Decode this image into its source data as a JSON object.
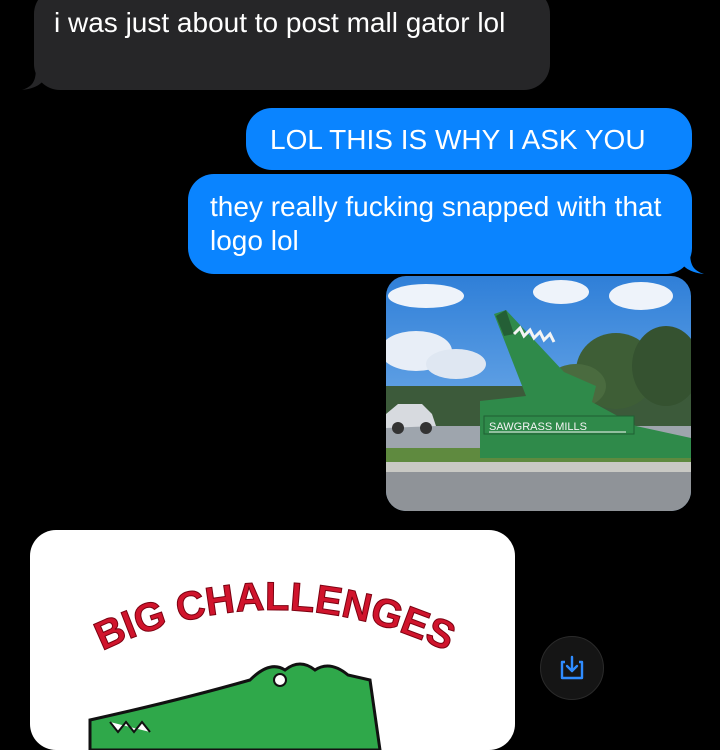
{
  "messages": [
    {
      "direction": "incoming",
      "text": "i was just about to post mall gator lol"
    },
    {
      "direction": "outgoing",
      "text": "LOL THIS IS WHY I ASK YOU"
    },
    {
      "direction": "outgoing",
      "text": "they really fucking snapped with that logo lol"
    }
  ],
  "photo": {
    "sign_text": "SAWGRASS MILLS",
    "description_icon": "gator-sign-photo"
  },
  "sticker": {
    "headline": "BIG CHALLENGES",
    "headline_color": "#d0142c",
    "gator_color": "#2fa84a"
  },
  "actions": {
    "save_icon": "save-download-icon"
  },
  "colors": {
    "outgoing_bubble": "#0a84ff",
    "incoming_bubble": "#262628",
    "background": "#000000"
  }
}
